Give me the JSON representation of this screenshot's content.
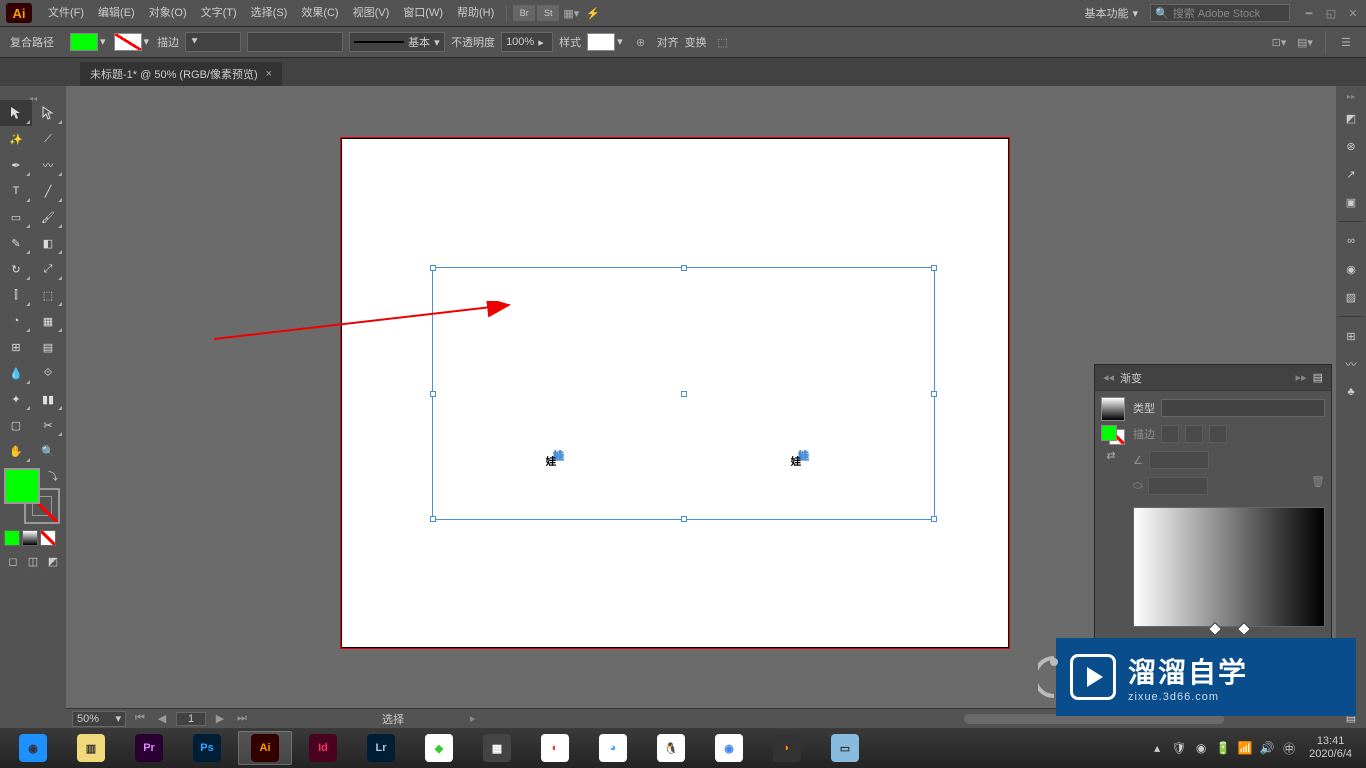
{
  "menubar": {
    "logo": "Ai",
    "items": [
      "文件(F)",
      "编辑(E)",
      "对象(O)",
      "文字(T)",
      "选择(S)",
      "效果(C)",
      "视图(V)",
      "窗口(W)",
      "帮助(H)"
    ],
    "workspace": "基本功能",
    "search_placeholder": "搜索 Adobe Stock"
  },
  "controlbar": {
    "object_type": "复合路径",
    "stroke_label": "描边",
    "stroke_profile": "基本",
    "opacity_label": "不透明度",
    "opacity_value": "100%",
    "style_label": "样式",
    "align_label": "对齐",
    "transform_label": "变换"
  },
  "doctab": {
    "title": "未标题-1* @ 50% (RGB/像素预览)"
  },
  "canvas": {
    "glyph_text": "娃娃"
  },
  "statusbar": {
    "zoom": "50%",
    "page": "1",
    "mode_label": "选择"
  },
  "panel": {
    "title": "渐变",
    "type_label": "类型",
    "stroke_label": "描边"
  },
  "watermark": {
    "brand": "溜溜自学",
    "url": "zixue.3d66.com"
  },
  "taskbar": {
    "apps": [
      {
        "name": "browser",
        "bg": "#1e90ff",
        "txt": "◉"
      },
      {
        "name": "explorer",
        "bg": "#f0d97b",
        "txt": "▥"
      },
      {
        "name": "premiere",
        "bg": "#2a0033",
        "txt": "Pr",
        "fg": "#e389ff"
      },
      {
        "name": "photoshop",
        "bg": "#001e36",
        "txt": "Ps",
        "fg": "#31a8ff"
      },
      {
        "name": "illustrator",
        "bg": "#330000",
        "txt": "Ai",
        "fg": "#ff9a00",
        "active": true
      },
      {
        "name": "indesign",
        "bg": "#49021f",
        "txt": "Id",
        "fg": "#ff3366"
      },
      {
        "name": "lightroom",
        "bg": "#001e36",
        "txt": "Lr",
        "fg": "#adc9d8"
      },
      {
        "name": "app1",
        "bg": "#fff",
        "txt": "◆",
        "fg": "#3c3"
      },
      {
        "name": "app2",
        "bg": "#444",
        "txt": "▦",
        "fg": "#fff"
      },
      {
        "name": "app3",
        "bg": "#fff",
        "txt": "◐",
        "fg": "#d33"
      },
      {
        "name": "app4",
        "bg": "#fff",
        "txt": "◕",
        "fg": "#3af"
      },
      {
        "name": "qq",
        "bg": "#fff",
        "txt": "🐧"
      },
      {
        "name": "chrome",
        "bg": "#fff",
        "txt": "◉",
        "fg": "#4285f4"
      },
      {
        "name": "app5",
        "bg": "#333",
        "txt": "◗",
        "fg": "#f80"
      },
      {
        "name": "notes",
        "bg": "#8bd",
        "txt": "▭"
      }
    ],
    "time": "13:41",
    "date": "2020/6/4"
  }
}
